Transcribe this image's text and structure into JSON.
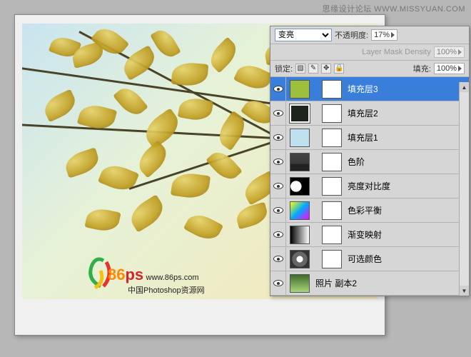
{
  "watermark": {
    "top": "思缘设计论坛  WWW.MISSYUAN.COM",
    "logo_big": "86",
    "logo_ps": "ps",
    "site": "www.86ps.com",
    "tagline": "中国Photoshop资源网"
  },
  "panel": {
    "blend_mode": "变亮",
    "opacity_label": "不透明度:",
    "opacity_value": "17%",
    "mask_density_label": "Layer Mask Density",
    "mask_density_value": "100%",
    "lock_label": "锁定:",
    "fill_label": "填充:",
    "fill_value": "100%"
  },
  "layers": [
    {
      "name": "填充层3",
      "thumb": "fill3",
      "selected": true
    },
    {
      "name": "填充层2",
      "thumb": "fill2",
      "selected": false
    },
    {
      "name": "填充层1",
      "thumb": "fill1",
      "selected": false
    },
    {
      "name": "色阶",
      "thumb": "levels",
      "selected": false
    },
    {
      "name": "亮度对比度",
      "thumb": "bc",
      "selected": false
    },
    {
      "name": "色彩平衡",
      "thumb": "cb",
      "selected": false
    },
    {
      "name": "渐变映射",
      "thumb": "gm",
      "selected": false
    },
    {
      "name": "可选颜色",
      "thumb": "sc",
      "selected": false
    },
    {
      "name": "照片 副本2",
      "thumb": "photo",
      "selected": false
    }
  ]
}
